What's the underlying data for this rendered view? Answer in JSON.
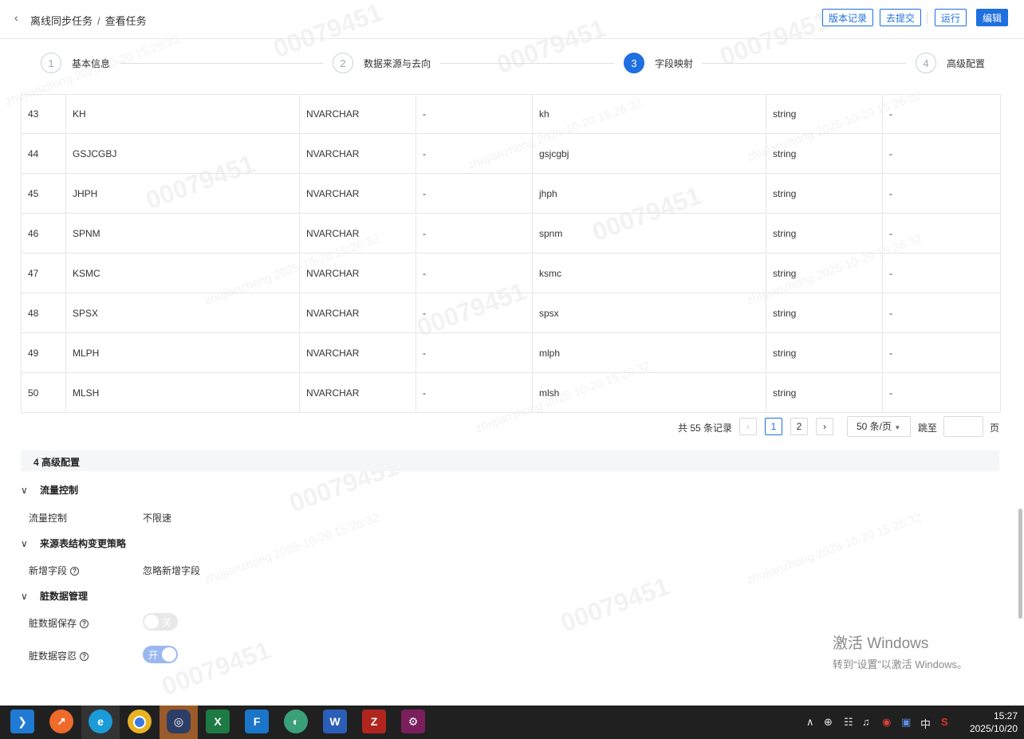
{
  "header": {
    "back_icon": "chevron-left-icon",
    "breadcrumb_parent": "离线同步任务",
    "breadcrumb_sep": "/",
    "breadcrumb_current": "查看任务",
    "btn_version": "版本记录",
    "btn_submit": "去提交",
    "btn_run": "运行",
    "btn_edit": "编辑"
  },
  "steps": [
    {
      "num": "1",
      "label": "基本信息",
      "active": false
    },
    {
      "num": "2",
      "label": "数据来源与去向",
      "active": false
    },
    {
      "num": "3",
      "label": "字段映射",
      "active": true
    },
    {
      "num": "4",
      "label": "高级配置",
      "active": false
    }
  ],
  "table": {
    "rows": [
      {
        "idx": "43",
        "src_field": "KH",
        "src_type": "NVARCHAR",
        "src_desc": "-",
        "dst_field": "kh",
        "dst_type": "string",
        "dst_desc": "-"
      },
      {
        "idx": "44",
        "src_field": "GSJCGBJ",
        "src_type": "NVARCHAR",
        "src_desc": "-",
        "dst_field": "gsjcgbj",
        "dst_type": "string",
        "dst_desc": "-"
      },
      {
        "idx": "45",
        "src_field": "JHPH",
        "src_type": "NVARCHAR",
        "src_desc": "-",
        "dst_field": "jhph",
        "dst_type": "string",
        "dst_desc": "-"
      },
      {
        "idx": "46",
        "src_field": "SPNM",
        "src_type": "NVARCHAR",
        "src_desc": "-",
        "dst_field": "spnm",
        "dst_type": "string",
        "dst_desc": "-"
      },
      {
        "idx": "47",
        "src_field": "KSMC",
        "src_type": "NVARCHAR",
        "src_desc": "-",
        "dst_field": "ksmc",
        "dst_type": "string",
        "dst_desc": "-"
      },
      {
        "idx": "48",
        "src_field": "SPSX",
        "src_type": "NVARCHAR",
        "src_desc": "-",
        "dst_field": "spsx",
        "dst_type": "string",
        "dst_desc": "-"
      },
      {
        "idx": "49",
        "src_field": "MLPH",
        "src_type": "NVARCHAR",
        "src_desc": "-",
        "dst_field": "mlph",
        "dst_type": "string",
        "dst_desc": "-"
      },
      {
        "idx": "50",
        "src_field": "MLSH",
        "src_type": "NVARCHAR",
        "src_desc": "-",
        "dst_field": "mlsh",
        "dst_type": "string",
        "dst_desc": "-"
      }
    ]
  },
  "pagination": {
    "total": "共 55 条记录",
    "prev_icon": "chevron-left-icon",
    "page1": "1",
    "page2": "2",
    "next_icon": "chevron-right-icon",
    "page_size": "50 条/页",
    "jump_label": "跳至",
    "jump_value": "",
    "page_unit": "页"
  },
  "advanced": {
    "section_title": "4 高级配置",
    "groups": {
      "flow": {
        "title": "流量控制",
        "label": "流量控制",
        "value": "不限速"
      },
      "schema": {
        "title": "来源表结构变更策略",
        "label": "新增字段",
        "value": "忽略新增字段"
      },
      "dirty": {
        "title": "脏数据管理",
        "save_label": "脏数据保存",
        "save_toggle": "关",
        "save_on": false,
        "tolerate_label": "脏数据容忍",
        "tolerate_toggle": "开",
        "tolerate_on": true
      }
    }
  },
  "windows_activation": {
    "title": "激活 Windows",
    "subtitle": "转到“设置”以激活 Windows。"
  },
  "watermark": {
    "id": "00079451",
    "user": "zhujianzhong 2025-10-20 15:26:32"
  },
  "taskbar": {
    "apps": [
      "vscode-icon",
      "postman-icon",
      "edge-icon",
      "chrome-icon",
      "app-icon",
      "excel-icon",
      "finereport-icon",
      "browser-icon",
      "word-icon",
      "filezilla-icon",
      "gitkraken-icon"
    ],
    "tray_ime": "中",
    "time": "15:27",
    "date": "2025/10/20"
  },
  "colors": {
    "accent": "#1e6fe0",
    "taskbar": "#202020"
  }
}
